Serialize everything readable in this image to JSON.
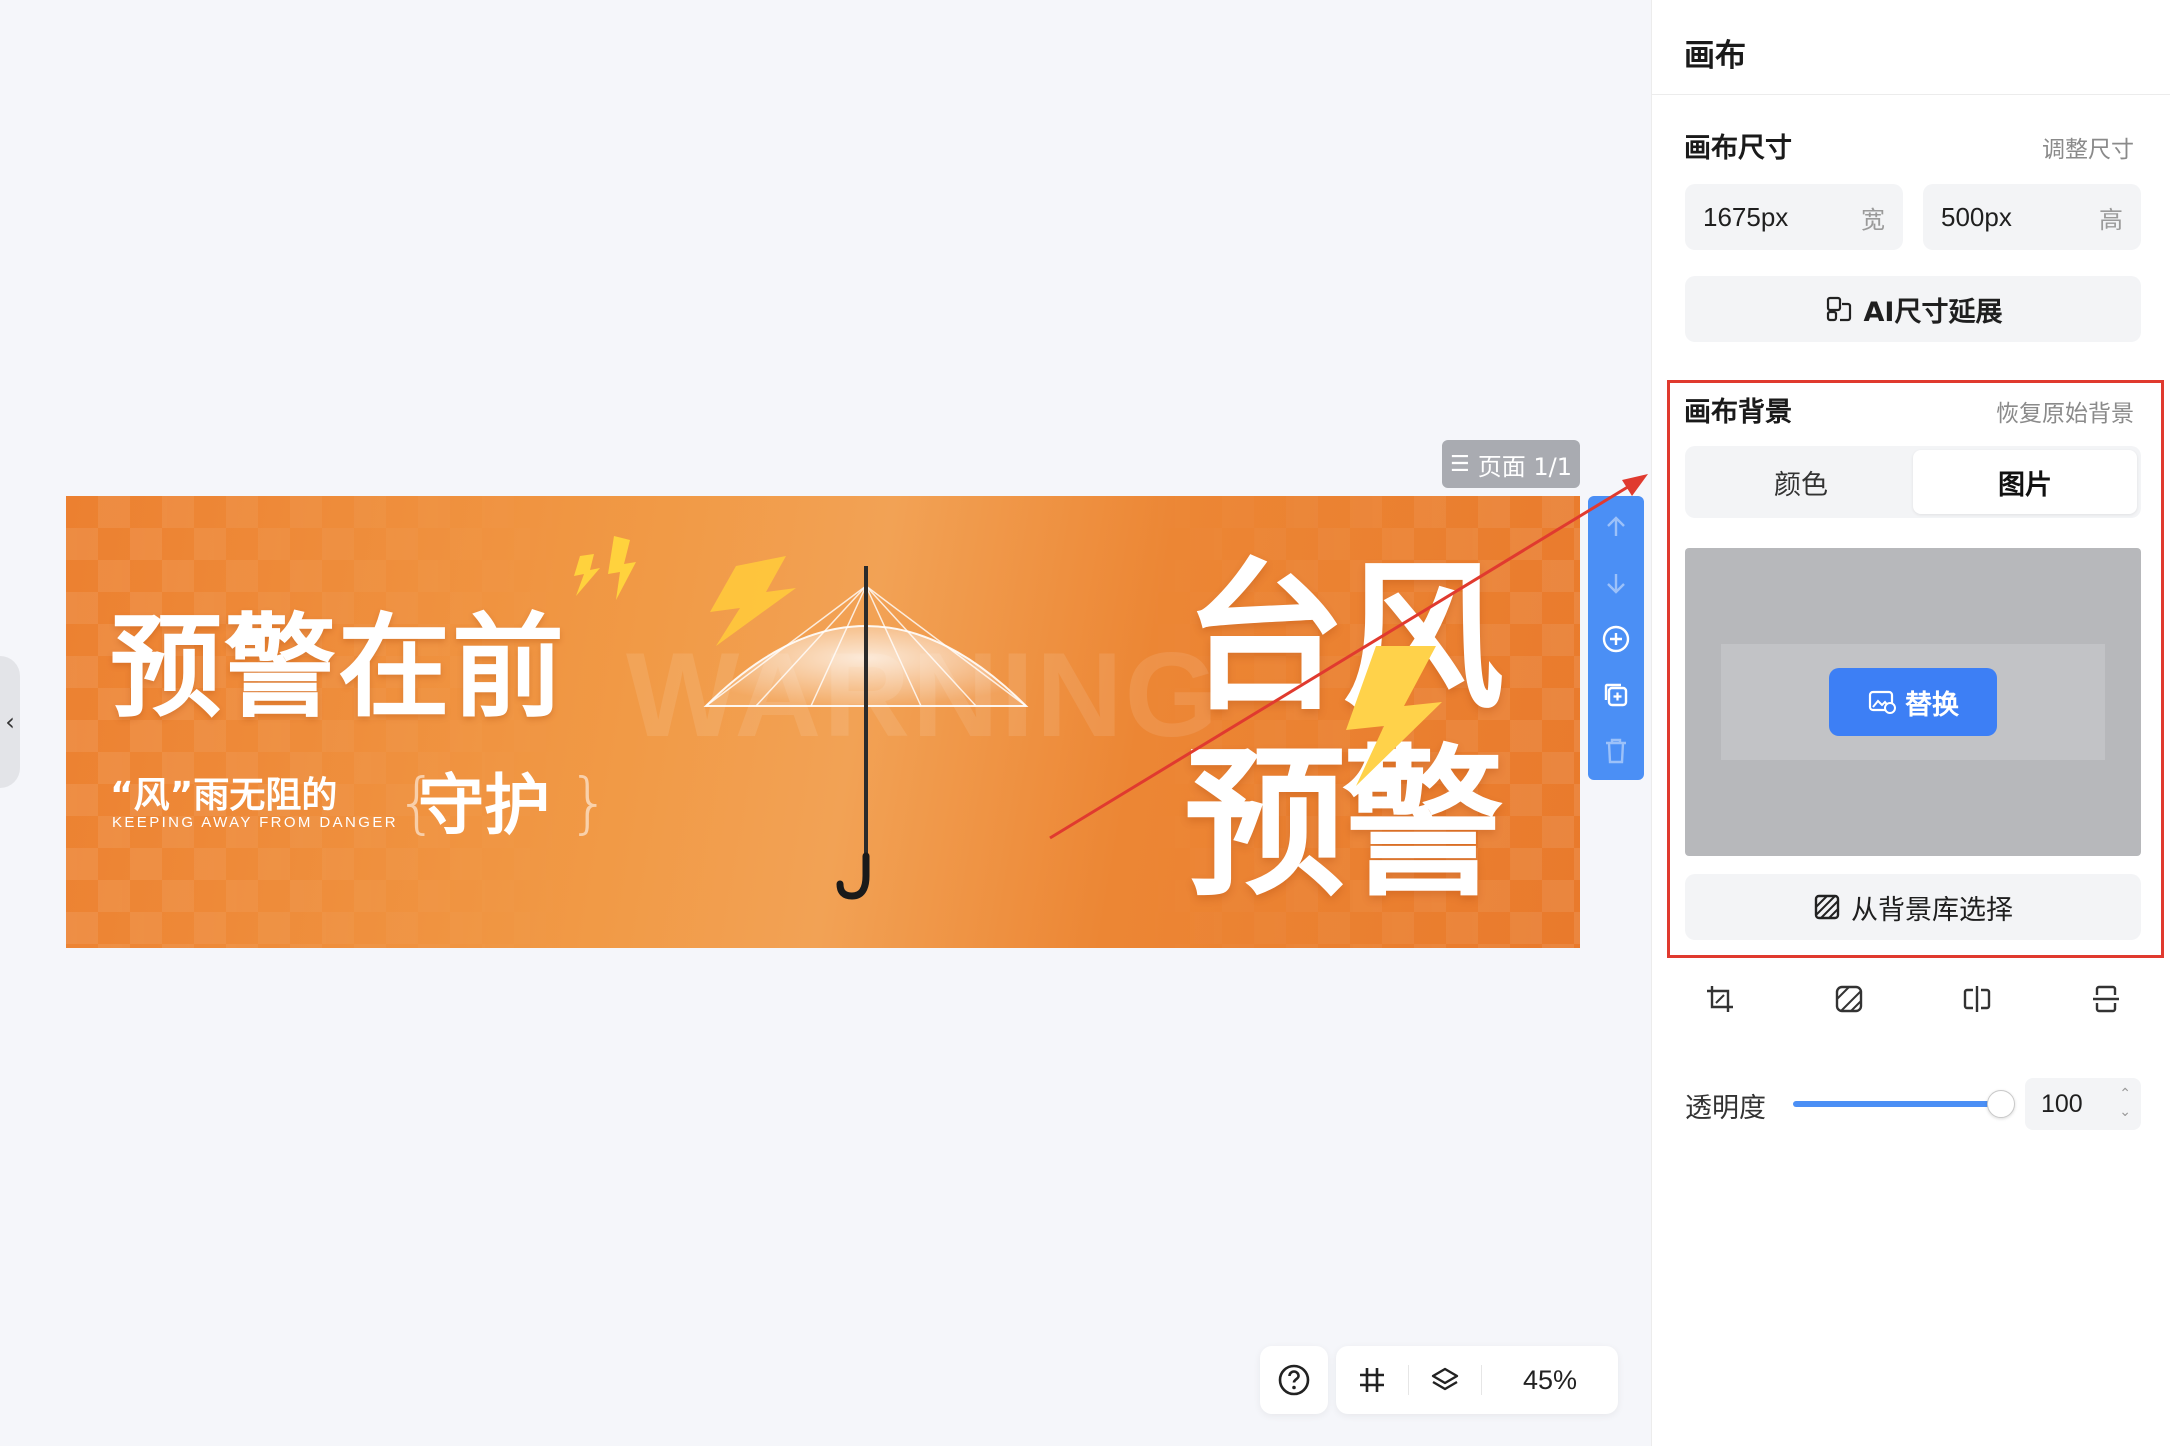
{
  "canvas": {
    "page_indicator": "页面 1/1",
    "banner": {
      "headline": "预警在前",
      "subline": "“风”雨无阻的",
      "subline_en": "KEEPING AWAY FROM DANGER",
      "guard_text": "守护",
      "watermark_word": "WARNING",
      "big_title_line1": "台风",
      "big_title_line2": "预警"
    }
  },
  "zoom_bar": {
    "zoom": "45%"
  },
  "panel": {
    "title": "画布",
    "size_section": {
      "title": "画布尺寸",
      "adjust_link": "调整尺寸",
      "width_value": "1675px",
      "width_unit": "宽",
      "height_value": "500px",
      "height_unit": "高",
      "ai_extend_label": "AI尺寸延展"
    },
    "background_section": {
      "title": "画布背景",
      "restore_link": "恢复原始背景",
      "tabs": [
        "颜色",
        "图片"
      ],
      "active_tab": "图片",
      "replace_label": "替换",
      "library_label": "从背景库选择"
    },
    "opacity": {
      "label": "透明度",
      "value": "100",
      "level": 1.0
    }
  },
  "colors": {
    "accent": "#3d7ff5",
    "toolbar_blue": "#4b8ff5",
    "annotation_red": "#e03a2f",
    "banner_orange": "#ec8030"
  }
}
